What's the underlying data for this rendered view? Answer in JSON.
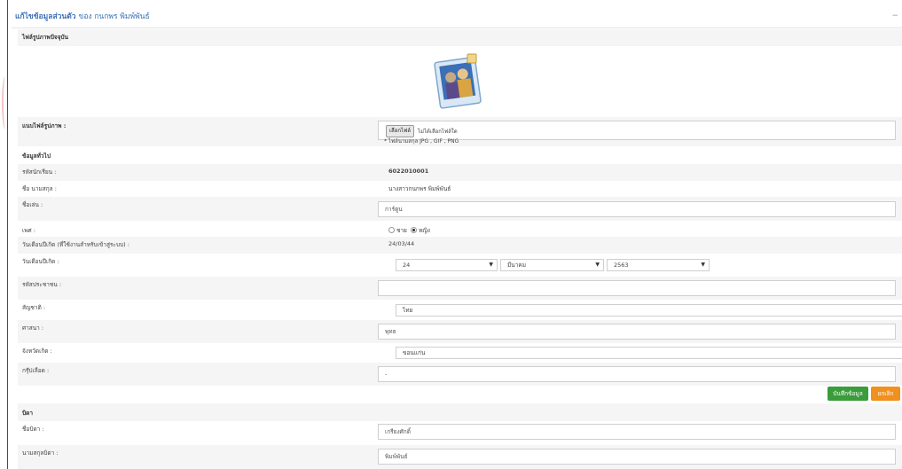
{
  "header": {
    "title": "แก้ไขข้อมูลส่วนตัว",
    "owner": "ของ กนกพร พิมพ์พันธ์",
    "collapse_icon": "−"
  },
  "photo_section": {
    "title": "ไฟล์รูปภาพปัจจุบัน",
    "image_icon": "photo-frame-icon"
  },
  "upload": {
    "label": "แนบไฟล์รูปภาพ :",
    "button": "เลือกไฟล์",
    "status": "ไม่ได้เลือกไฟล์ใด",
    "hint": "* ไฟล์นามสกุล JPG , GIF , PNG"
  },
  "general": {
    "title": "ข้อมูลทั่วไป"
  },
  "fields": {
    "student_id": {
      "label": "รหัสนักเรียน :",
      "value": "6022010001"
    },
    "fullname": {
      "label": "ชื่อ นามสกุล :",
      "value": "นางสาวกนกพร พิมพ์พันธ์"
    },
    "nickname": {
      "label": "ชื่อเล่น :",
      "value": "การ์ตูน"
    },
    "gender": {
      "label": "เพศ :",
      "options": [
        "ชาย",
        "หญิง"
      ],
      "selected": "หญิง"
    },
    "birth_login": {
      "label": "วันเดือนปีเกิด (ที่ใช้งานสำหรับเข้าสู่ระบบ) :",
      "value": "24/03/44"
    },
    "birthdate": {
      "label": "วันเดือนปีเกิด :",
      "day": "24",
      "month": "มีนาคม",
      "year": "2563"
    },
    "citizen_id": {
      "label": "รหัสประชาชน :",
      "value": ""
    },
    "nationality": {
      "label": "สัญชาติ :",
      "value": "ไทย"
    },
    "religion": {
      "label": "ศาสนา :",
      "value": "พุทธ"
    },
    "province": {
      "label": "จังหวัดเกิด :",
      "value": "ขอนแก่น"
    },
    "blood": {
      "label": "กรุ๊ปเลือด :",
      "value": "-"
    }
  },
  "actions": {
    "save": "บันทึกข้อมูล",
    "cancel": "ยกเลิก",
    "save_color": "#3a9c3a",
    "cancel_color": "#f0901e"
  },
  "father": {
    "title": "บิดา",
    "name": {
      "label": "ชื่อบิดา :",
      "value": "เกรียงศักดิ์"
    },
    "surname": {
      "label": "นามสกุลบิดา :",
      "value": "พิมพ์พันธ์"
    }
  }
}
